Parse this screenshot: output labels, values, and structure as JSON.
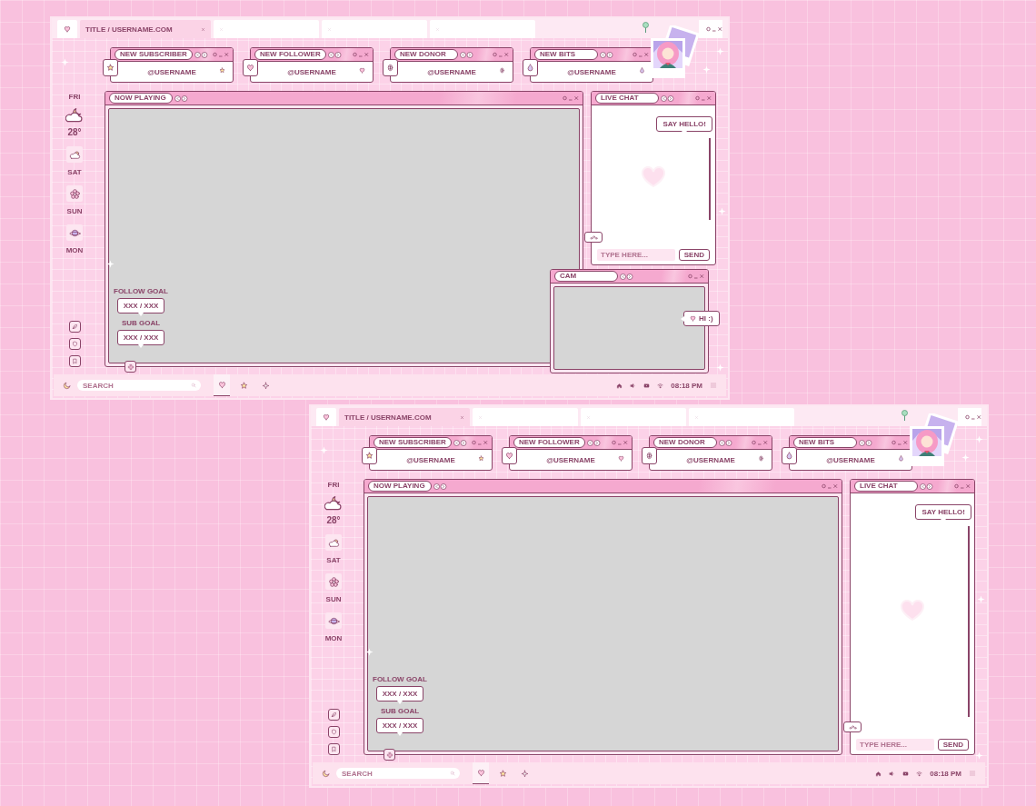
{
  "screens": [
    {
      "tabs": [
        {
          "label": "TITLE / USERNAME.COM",
          "selected": true
        },
        {
          "selected": false
        },
        {
          "selected": false
        },
        {
          "selected": false
        }
      ],
      "alerts": [
        {
          "label": "NEW SUBSCRIBER",
          "user": "@USERNAME",
          "kind": "star"
        },
        {
          "label": "NEW FOLLOWER",
          "user": "@USERNAME",
          "kind": "heart"
        },
        {
          "label": "NEW DONOR",
          "user": "@USERNAME",
          "kind": "coin"
        },
        {
          "label": "NEW BITS",
          "user": "@USERNAME",
          "kind": "drop"
        }
      ],
      "weather": {
        "day": "FRI",
        "temp": "28°",
        "forecast": [
          {
            "day": "SAT",
            "kind": "cloud"
          },
          {
            "day": "SUN",
            "kind": "flower"
          },
          {
            "day": "MON",
            "kind": "planet"
          }
        ]
      },
      "now_playing": {
        "title": "NOW PLAYING",
        "goals": [
          {
            "label": "FOLLOW GOAL",
            "value": "XXX / XXX"
          },
          {
            "label": "SUB GOAL",
            "value": "XXX / XXX"
          }
        ]
      },
      "chat": {
        "title": "LIVE CHAT",
        "bubble": "SAY HELLO!",
        "placeholder": "TYPE HERE...",
        "send": "SEND"
      },
      "cam": {
        "title": "CAM",
        "bubble": "HI :)"
      },
      "taskbar": {
        "search_placeholder": "SEARCH",
        "tabs": [
          {
            "kind": "heart",
            "selected": true
          },
          {
            "kind": "star",
            "selected": false
          },
          {
            "kind": "sparkle",
            "selected": false
          }
        ],
        "time": "08:18 PM"
      }
    },
    {
      "tabs": [
        {
          "label": "TITLE / USERNAME.COM",
          "selected": true
        },
        {
          "selected": false
        },
        {
          "selected": false
        },
        {
          "selected": false
        }
      ],
      "alerts": [
        {
          "label": "NEW SUBSCRIBER",
          "user": "@USERNAME",
          "kind": "star"
        },
        {
          "label": "NEW FOLLOWER",
          "user": "@USERNAME",
          "kind": "heart"
        },
        {
          "label": "NEW DONOR",
          "user": "@USERNAME",
          "kind": "coin"
        },
        {
          "label": "NEW BITS",
          "user": "@USERNAME",
          "kind": "drop"
        }
      ],
      "weather": {
        "day": "FRI",
        "temp": "28°",
        "forecast": [
          {
            "day": "SAT",
            "kind": "cloud"
          },
          {
            "day": "SUN",
            "kind": "flower"
          },
          {
            "day": "MON",
            "kind": "planet"
          }
        ]
      },
      "now_playing": {
        "title": "NOW PLAYING",
        "goals": [
          {
            "label": "FOLLOW GOAL",
            "value": "XXX / XXX"
          },
          {
            "label": "SUB GOAL",
            "value": "XXX / XXX"
          }
        ]
      },
      "chat": {
        "title": "LIVE CHAT",
        "bubble": "SAY HELLO!",
        "placeholder": "TYPE HERE...",
        "send": "SEND"
      },
      "taskbar": {
        "search_placeholder": "SEARCH",
        "tabs": [
          {
            "kind": "heart",
            "selected": true
          },
          {
            "kind": "star",
            "selected": false
          },
          {
            "kind": "sparkle",
            "selected": false
          }
        ],
        "time": "08:18 PM"
      }
    }
  ]
}
